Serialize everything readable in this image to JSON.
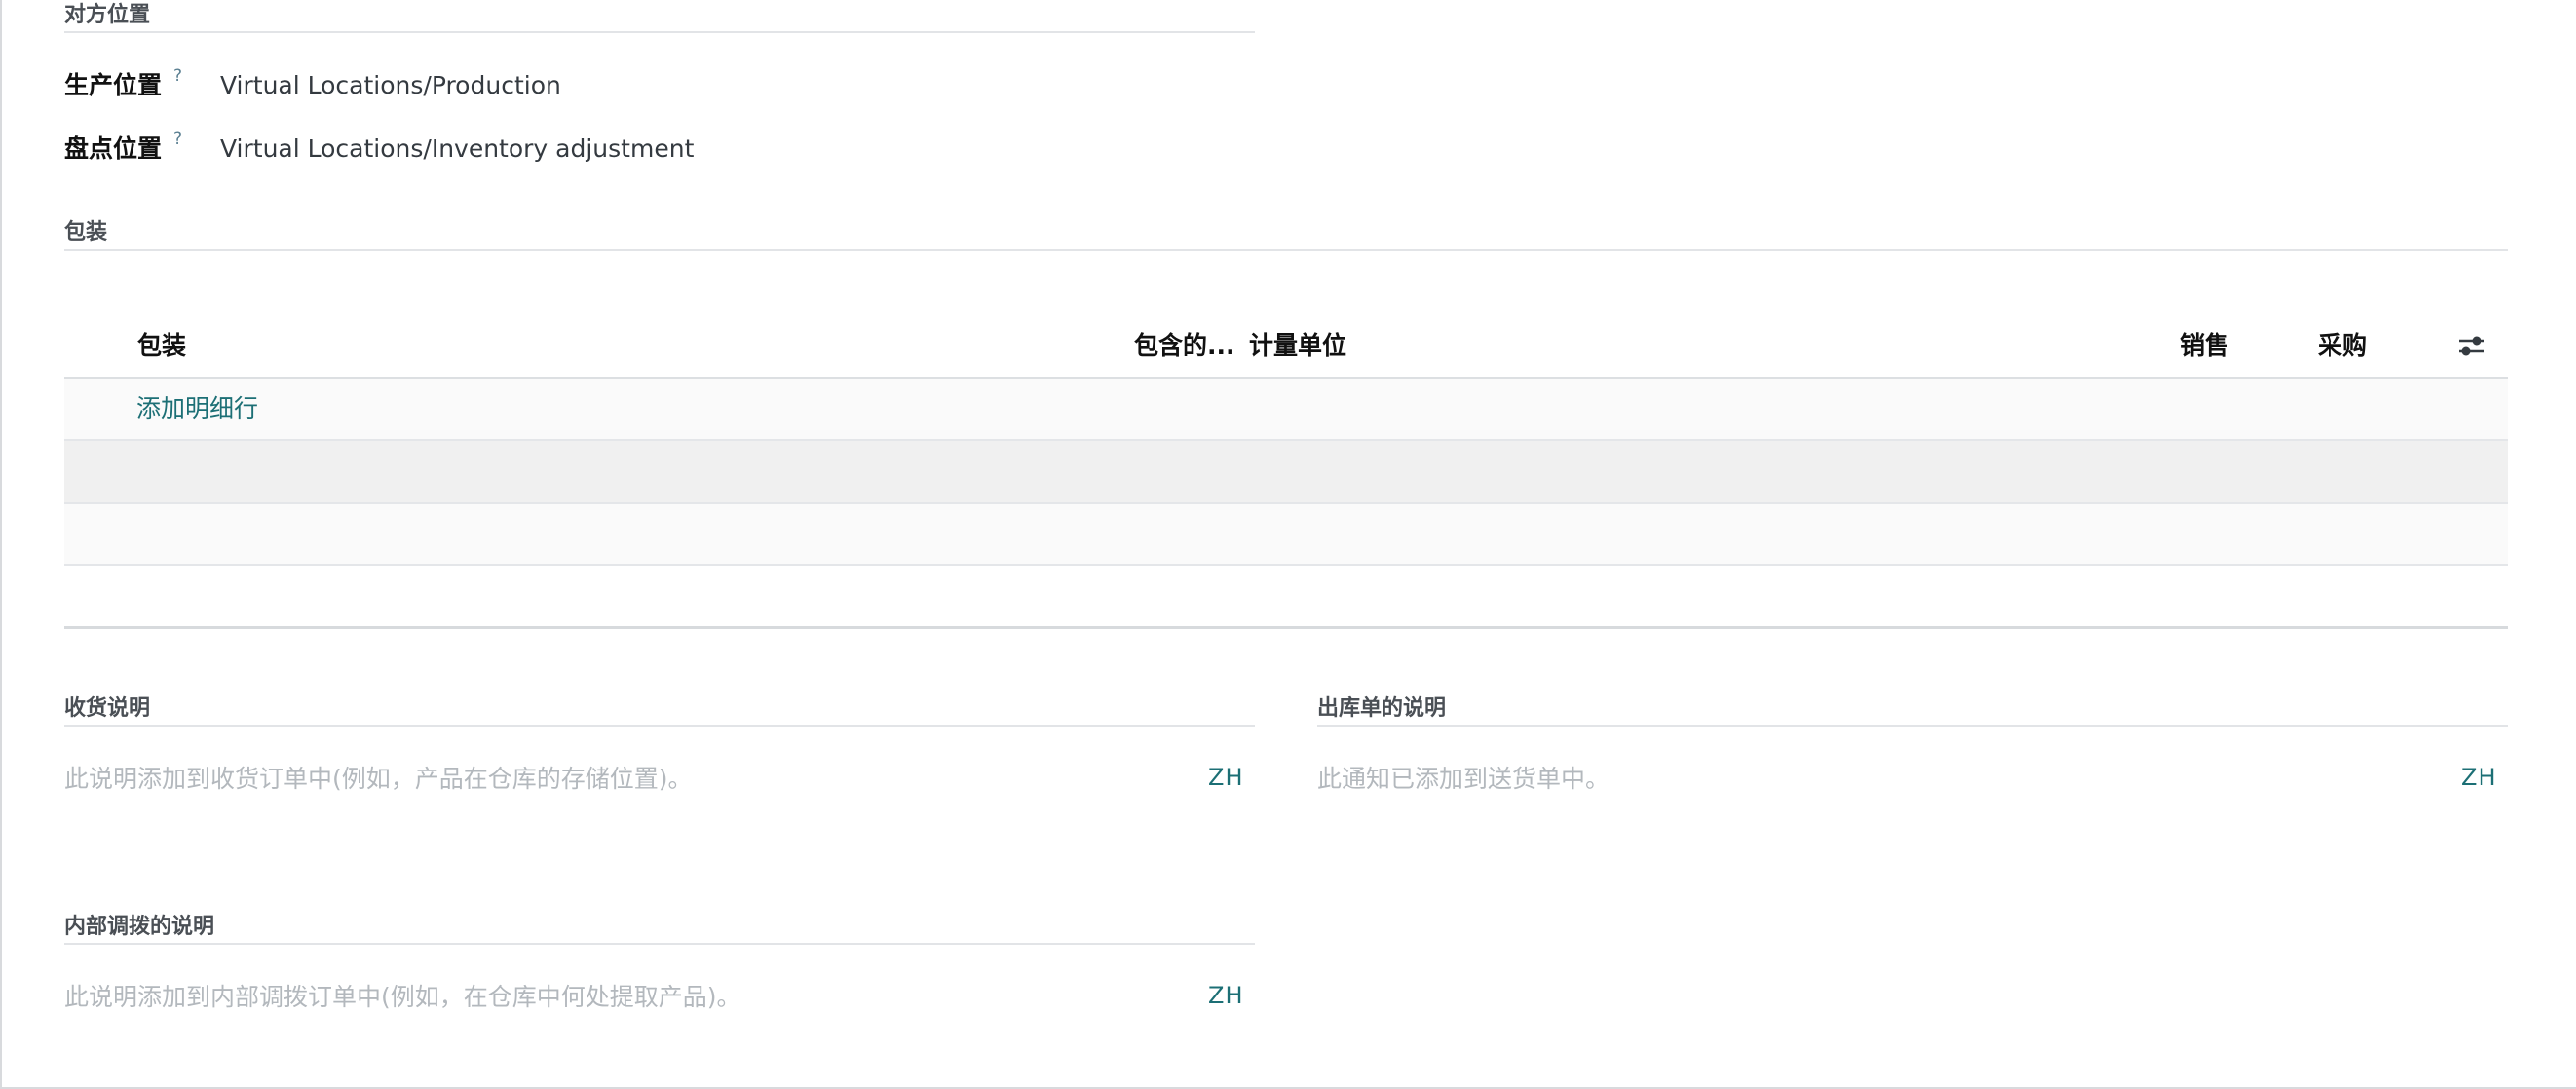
{
  "counterpart": {
    "section_title": "对方位置",
    "production": {
      "label": "生产位置",
      "help": "?",
      "value": "Virtual Locations/Production"
    },
    "inventory": {
      "label": "盘点位置",
      "help": "?",
      "value": "Virtual Locations/Inventory adjustment"
    }
  },
  "packaging": {
    "section_title": "包装",
    "columns": {
      "name": "包装",
      "qty": "包含的...",
      "uom": "计量单位",
      "sales": "销售",
      "purchase": "采购"
    },
    "add_line": "添加明细行",
    "settings_icon": "sliders-icon"
  },
  "notes": {
    "receipt": {
      "title": "收货说明",
      "placeholder": "此说明添加到收货订单中(例如，产品在仓库的存储位置)。",
      "lang": "ZH"
    },
    "delivery": {
      "title": "出库单的说明",
      "placeholder": "此通知已添加到送货单中。",
      "lang": "ZH"
    },
    "internal": {
      "title": "内部调拨的说明",
      "placeholder": "此说明添加到内部调拨订单中(例如，在仓库中何处提取产品)。",
      "lang": "ZH"
    }
  }
}
